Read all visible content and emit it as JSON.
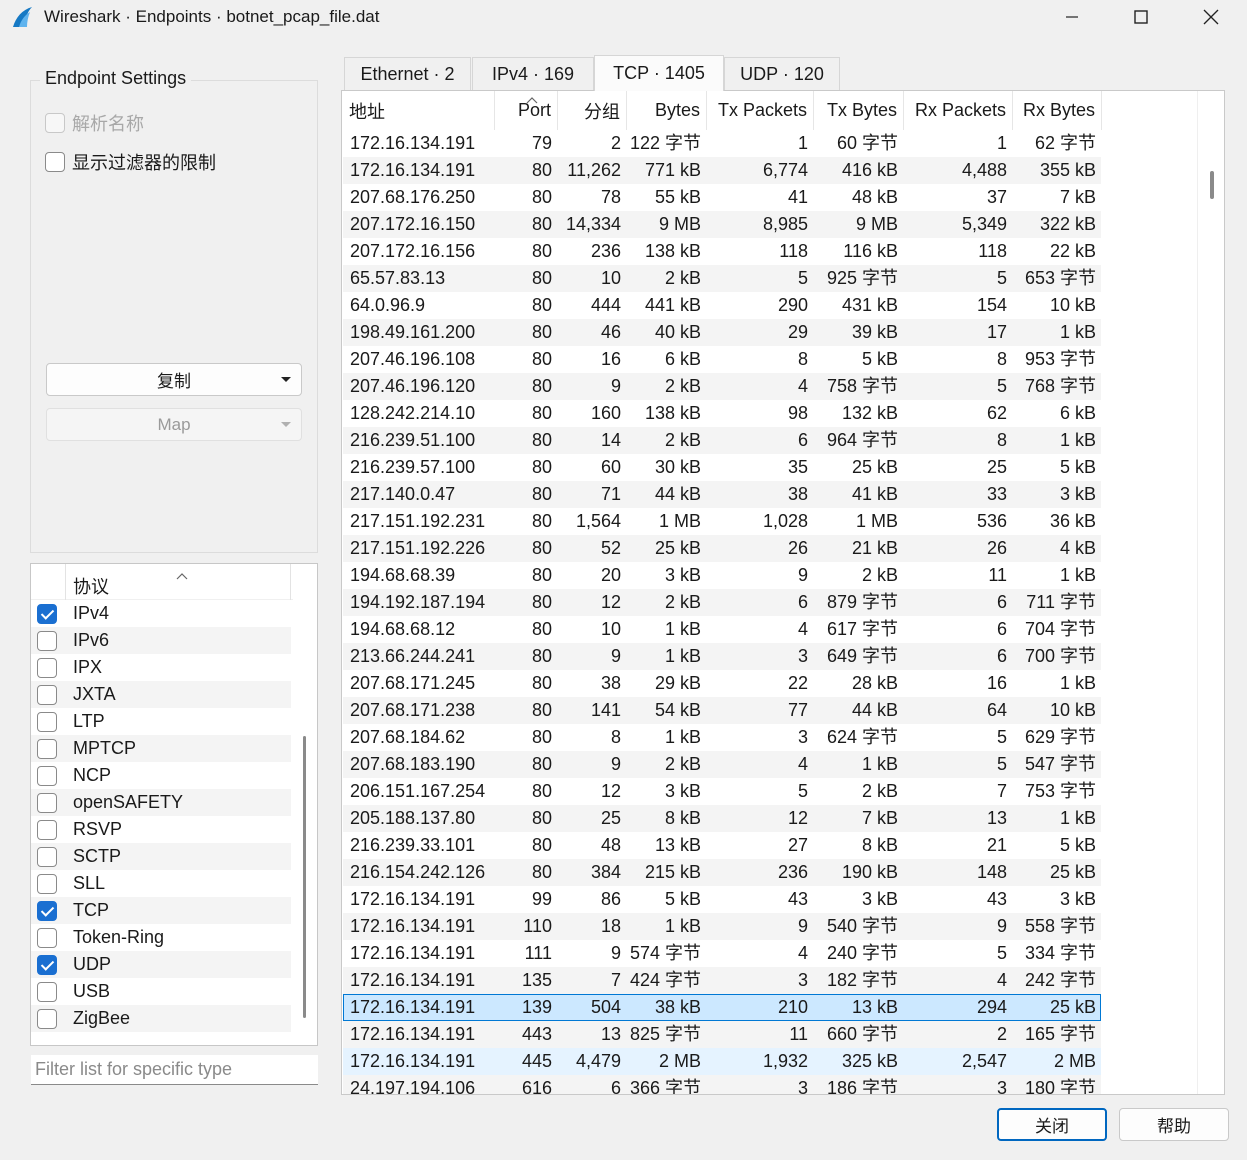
{
  "window": {
    "title": "Wireshark · Endpoints · botnet_pcap_file.dat"
  },
  "settings": {
    "title": "Endpoint Settings",
    "resolve_names": "解析名称",
    "limit_filter": "显示过滤器的限制",
    "copy_label": "复制",
    "map_label": "Map"
  },
  "protocols": {
    "header": "协议",
    "items": [
      {
        "name": "IPv4",
        "checked": true
      },
      {
        "name": "IPv6",
        "checked": false
      },
      {
        "name": "IPX",
        "checked": false
      },
      {
        "name": "JXTA",
        "checked": false
      },
      {
        "name": "LTP",
        "checked": false
      },
      {
        "name": "MPTCP",
        "checked": false
      },
      {
        "name": "NCP",
        "checked": false
      },
      {
        "name": "openSAFETY",
        "checked": false
      },
      {
        "name": "RSVP",
        "checked": false
      },
      {
        "name": "SCTP",
        "checked": false
      },
      {
        "name": "SLL",
        "checked": false
      },
      {
        "name": "TCP",
        "checked": true
      },
      {
        "name": "Token-Ring",
        "checked": false
      },
      {
        "name": "UDP",
        "checked": true
      },
      {
        "name": "USB",
        "checked": false
      },
      {
        "name": "ZigBee",
        "checked": false
      }
    ],
    "filter_placeholder": "Filter list for specific type"
  },
  "tabs": [
    {
      "label": "Ethernet · 2"
    },
    {
      "label": "IPv4 · 169"
    },
    {
      "label": "TCP · 1405"
    },
    {
      "label": "UDP · 120"
    }
  ],
  "table": {
    "columns": [
      "地址",
      "Port",
      "分组",
      "Bytes",
      "Tx Packets",
      "Tx Bytes",
      "Rx Packets",
      "Rx Bytes"
    ],
    "rows": [
      [
        "172.16.134.191",
        "79",
        "2",
        "122 字节",
        "1",
        "60 字节",
        "1",
        "62 字节"
      ],
      [
        "172.16.134.191",
        "80",
        "11,262",
        "771 kB",
        "6,774",
        "416 kB",
        "4,488",
        "355 kB"
      ],
      [
        "207.68.176.250",
        "80",
        "78",
        "55 kB",
        "41",
        "48 kB",
        "37",
        "7 kB"
      ],
      [
        "207.172.16.150",
        "80",
        "14,334",
        "9 MB",
        "8,985",
        "9 MB",
        "5,349",
        "322 kB"
      ],
      [
        "207.172.16.156",
        "80",
        "236",
        "138 kB",
        "118",
        "116 kB",
        "118",
        "22 kB"
      ],
      [
        "65.57.83.13",
        "80",
        "10",
        "2 kB",
        "5",
        "925 字节",
        "5",
        "653 字节"
      ],
      [
        "64.0.96.9",
        "80",
        "444",
        "441 kB",
        "290",
        "431 kB",
        "154",
        "10 kB"
      ],
      [
        "198.49.161.200",
        "80",
        "46",
        "40 kB",
        "29",
        "39 kB",
        "17",
        "1 kB"
      ],
      [
        "207.46.196.108",
        "80",
        "16",
        "6 kB",
        "8",
        "5 kB",
        "8",
        "953 字节"
      ],
      [
        "207.46.196.120",
        "80",
        "9",
        "2 kB",
        "4",
        "758 字节",
        "5",
        "768 字节"
      ],
      [
        "128.242.214.10",
        "80",
        "160",
        "138 kB",
        "98",
        "132 kB",
        "62",
        "6 kB"
      ],
      [
        "216.239.51.100",
        "80",
        "14",
        "2 kB",
        "6",
        "964 字节",
        "8",
        "1 kB"
      ],
      [
        "216.239.57.100",
        "80",
        "60",
        "30 kB",
        "35",
        "25 kB",
        "25",
        "5 kB"
      ],
      [
        "217.140.0.47",
        "80",
        "71",
        "44 kB",
        "38",
        "41 kB",
        "33",
        "3 kB"
      ],
      [
        "217.151.192.231",
        "80",
        "1,564",
        "1 MB",
        "1,028",
        "1 MB",
        "536",
        "36 kB"
      ],
      [
        "217.151.192.226",
        "80",
        "52",
        "25 kB",
        "26",
        "21 kB",
        "26",
        "4 kB"
      ],
      [
        "194.68.68.39",
        "80",
        "20",
        "3 kB",
        "9",
        "2 kB",
        "11",
        "1 kB"
      ],
      [
        "194.192.187.194",
        "80",
        "12",
        "2 kB",
        "6",
        "879 字节",
        "6",
        "711 字节"
      ],
      [
        "194.68.68.12",
        "80",
        "10",
        "1 kB",
        "4",
        "617 字节",
        "6",
        "704 字节"
      ],
      [
        "213.66.244.241",
        "80",
        "9",
        "1 kB",
        "3",
        "649 字节",
        "6",
        "700 字节"
      ],
      [
        "207.68.171.245",
        "80",
        "38",
        "29 kB",
        "22",
        "28 kB",
        "16",
        "1 kB"
      ],
      [
        "207.68.171.238",
        "80",
        "141",
        "54 kB",
        "77",
        "44 kB",
        "64",
        "10 kB"
      ],
      [
        "207.68.184.62",
        "80",
        "8",
        "1 kB",
        "3",
        "624 字节",
        "5",
        "629 字节"
      ],
      [
        "207.68.183.190",
        "80",
        "9",
        "2 kB",
        "4",
        "1 kB",
        "5",
        "547 字节"
      ],
      [
        "206.151.167.254",
        "80",
        "12",
        "3 kB",
        "5",
        "2 kB",
        "7",
        "753 字节"
      ],
      [
        "205.188.137.80",
        "80",
        "25",
        "8 kB",
        "12",
        "7 kB",
        "13",
        "1 kB"
      ],
      [
        "216.239.33.101",
        "80",
        "48",
        "13 kB",
        "27",
        "8 kB",
        "21",
        "5 kB"
      ],
      [
        "216.154.242.126",
        "80",
        "384",
        "215 kB",
        "236",
        "190 kB",
        "148",
        "25 kB"
      ],
      [
        "172.16.134.191",
        "99",
        "86",
        "5 kB",
        "43",
        "3 kB",
        "43",
        "3 kB"
      ],
      [
        "172.16.134.191",
        "110",
        "18",
        "1 kB",
        "9",
        "540 字节",
        "9",
        "558 字节"
      ],
      [
        "172.16.134.191",
        "111",
        "9",
        "574 字节",
        "4",
        "240 字节",
        "5",
        "334 字节"
      ],
      [
        "172.16.134.191",
        "135",
        "7",
        "424 字节",
        "3",
        "182 字节",
        "4",
        "242 字节"
      ],
      [
        "172.16.134.191",
        "139",
        "504",
        "38 kB",
        "210",
        "13 kB",
        "294",
        "25 kB"
      ],
      [
        "172.16.134.191",
        "443",
        "13",
        "825 字节",
        "11",
        "660 字节",
        "2",
        "165 字节"
      ],
      [
        "172.16.134.191",
        "445",
        "4,479",
        "2 MB",
        "1,932",
        "325 kB",
        "2,547",
        "2 MB"
      ],
      [
        "24.197.194.106",
        "616",
        "6",
        "366 字节",
        "3",
        "186 字节",
        "3",
        "180 字节"
      ]
    ]
  },
  "buttons": {
    "close": "关闭",
    "help": "帮助"
  }
}
